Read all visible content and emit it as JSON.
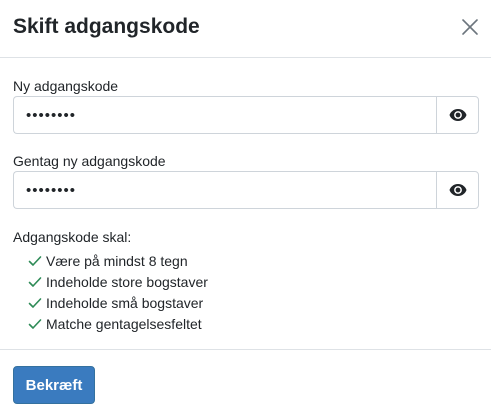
{
  "modal": {
    "title": "Skift adgangskode"
  },
  "fields": {
    "new_password": {
      "label": "Ny adgangskode",
      "value": "••••••••"
    },
    "repeat_password": {
      "label": "Gentag ny adgangskode",
      "value": "••••••••"
    }
  },
  "requirements": {
    "title": "Adgangskode skal:",
    "items": [
      {
        "label": "Være på mindst 8 tegn",
        "met": true
      },
      {
        "label": "Indeholde store bogstaver",
        "met": true
      },
      {
        "label": "Indeholde små bogstaver",
        "met": true
      },
      {
        "label": "Matche gentagelsesfeltet",
        "met": true
      }
    ]
  },
  "footer": {
    "confirm_label": "Bekræft"
  },
  "icons": {
    "close": "close-icon",
    "toggle_visibility": "eye-icon",
    "requirement_met": "check-icon"
  },
  "colors": {
    "primary": "#3a7bbf",
    "success": "#2e8b57",
    "border": "#ced4da",
    "divider": "#dee2e6"
  }
}
